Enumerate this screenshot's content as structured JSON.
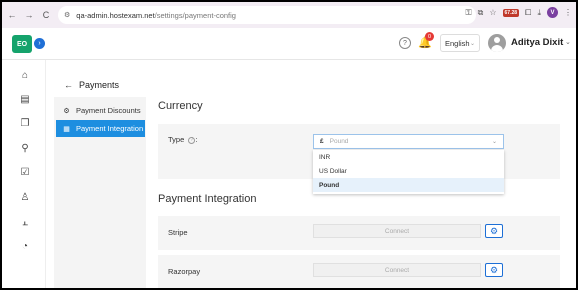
{
  "browser": {
    "back": "←",
    "forward": "→",
    "reload": "C",
    "url_host": "qa-admin.hostexam.net",
    "url_path": "/settings/payment-config",
    "ext_badge": "67.28",
    "profile_initial": "V"
  },
  "header": {
    "logo_text": "EO",
    "expand_icon": "›",
    "notification_count": "0",
    "language": "English",
    "user_name": "Aditya Dixit"
  },
  "page": {
    "back_icon": "←",
    "title": "Payments"
  },
  "side_menu": {
    "items": [
      {
        "label": "Payment Discounts",
        "icon": "gear-circle-icon"
      },
      {
        "label": "Payment Integration",
        "icon": "card-stack-icon"
      }
    ]
  },
  "currency": {
    "section_title": "Currency",
    "type_label": "Type",
    "info_icon": "?",
    "selected_symbol": "£",
    "selected_value": "Pound",
    "options": [
      "INR",
      "US Dollar",
      "Pound"
    ]
  },
  "integration": {
    "section_title": "Payment Integration",
    "providers": [
      {
        "name": "Stripe",
        "connect_label": "Connect"
      },
      {
        "name": "Razorpay",
        "connect_label": "Connect"
      }
    ]
  },
  "colors": {
    "brand_green": "#15a36c",
    "accent_blue": "#1d8ee0",
    "badge_red": "#e53935"
  }
}
